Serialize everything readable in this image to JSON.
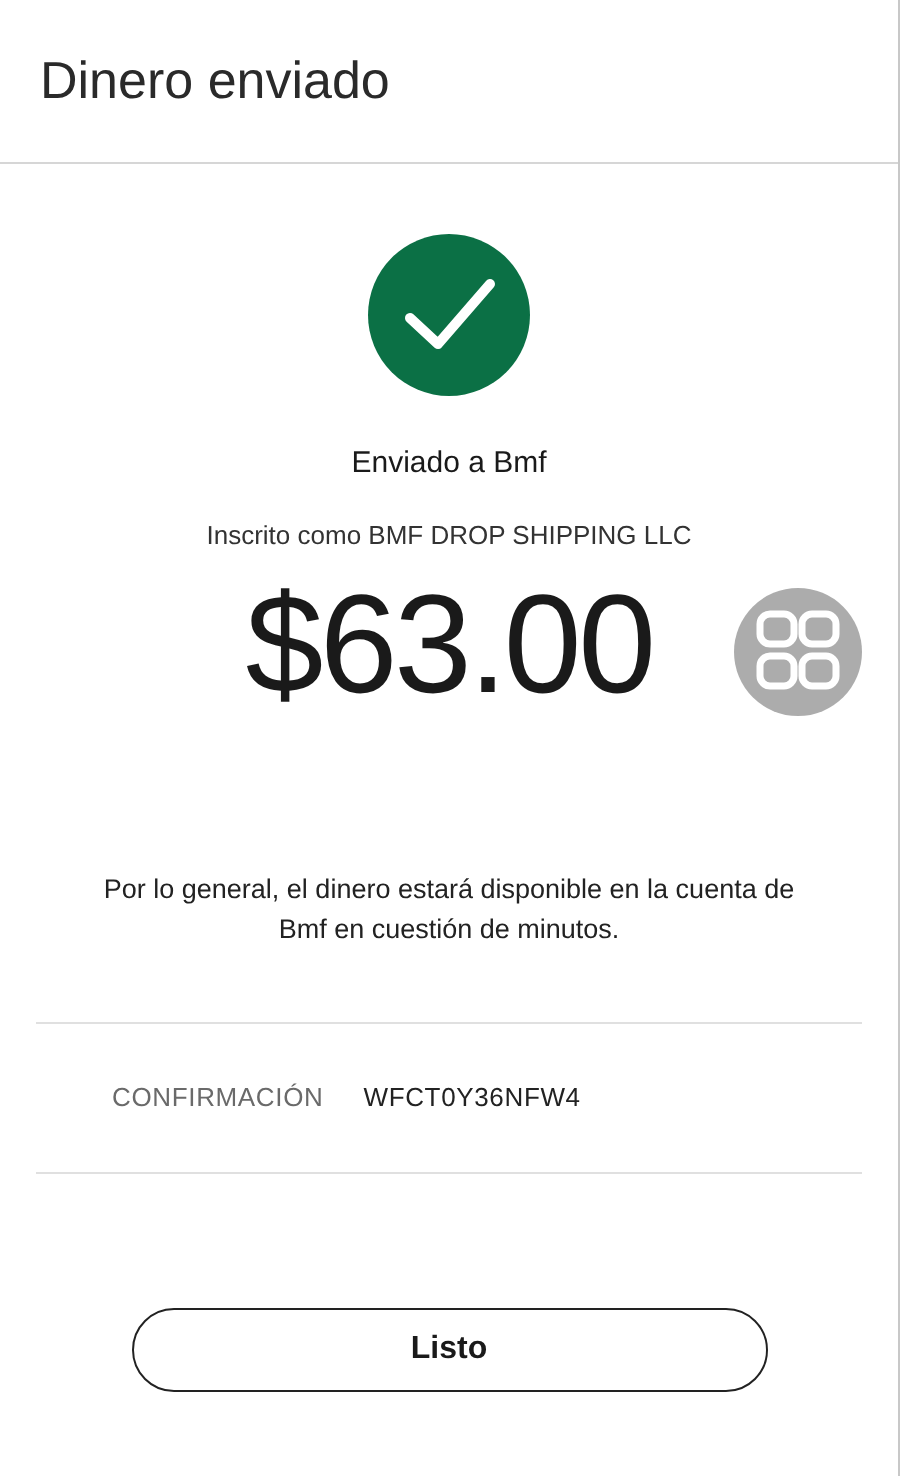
{
  "header": {
    "title": "Dinero enviado"
  },
  "status": {
    "kind": "success"
  },
  "recipient": "Enviado a Bmf",
  "enrolled_as": "Inscrito como BMF DROP SHIPPING LLC",
  "amount": "$63.00",
  "note": "Por lo general, el dinero estará disponible en la cuenta de Bmf en cuestión de minutos.",
  "confirmation": {
    "label": "CONFIRMACIÓN",
    "value": "WFCT0Y36NFW4"
  },
  "buttons": [
    {
      "label": "Listo"
    }
  ]
}
